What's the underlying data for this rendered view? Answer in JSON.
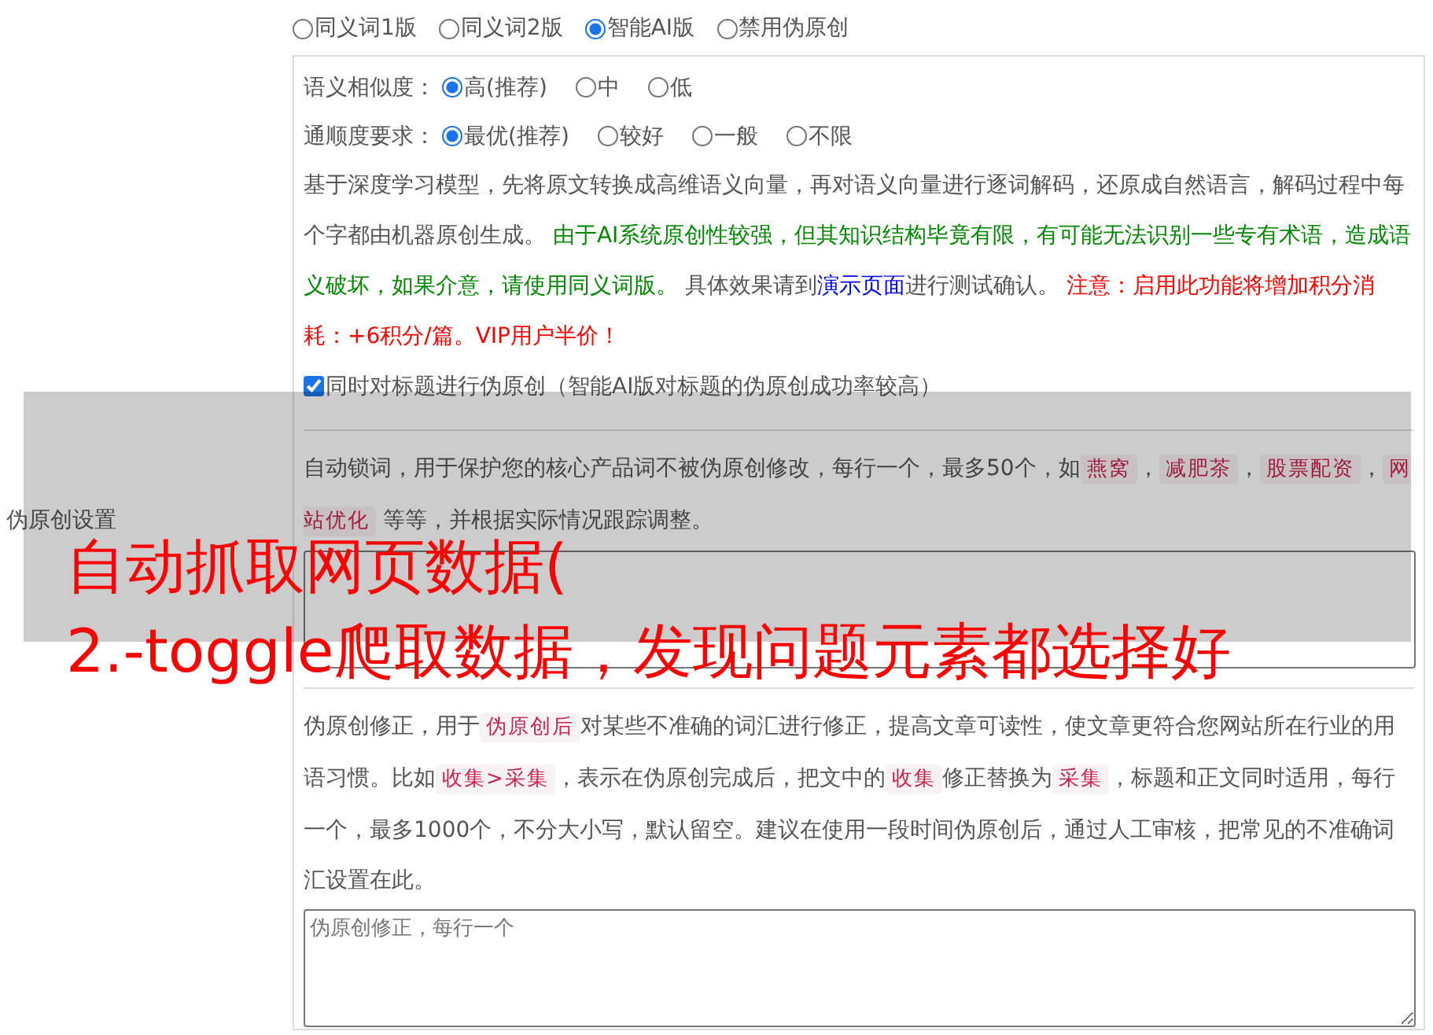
{
  "mode_options": [
    {
      "label": "同义词1版",
      "selected": false
    },
    {
      "label": "同义词2版",
      "selected": false
    },
    {
      "label": "智能AI版",
      "selected": true
    },
    {
      "label": "禁用伪原创",
      "selected": false
    }
  ],
  "settings_label": "伪原创设置",
  "similarity": {
    "label": "语义相似度：",
    "options": [
      {
        "label": "高(推荐)",
        "selected": true
      },
      {
        "label": "中",
        "selected": false
      },
      {
        "label": "低",
        "selected": false
      }
    ]
  },
  "fluency": {
    "label": "通顺度要求：",
    "options": [
      {
        "label": "最优(推荐)",
        "selected": true
      },
      {
        "label": "较好",
        "selected": false
      },
      {
        "label": "一般",
        "selected": false
      },
      {
        "label": "不限",
        "selected": false
      }
    ]
  },
  "ai_description": [
    {
      "kind": "plain",
      "text": "基于深度学习模型，先将原文转换成高维语义向量，再对语义向量进行逐词解码，还原成自然语言，解码过程中每个字都由机器原创生成。 "
    },
    {
      "kind": "green",
      "text": "由于AI系统原创性较强，但其知识结构毕竟有限，有可能无法识别一些专有术语，造成语义破坏，如果介意，请使用同义词版。"
    },
    {
      "kind": "plain",
      "text": " 具体效果请到"
    },
    {
      "kind": "link",
      "text": "演示页面"
    },
    {
      "kind": "plain",
      "text": "进行测试确认。 "
    },
    {
      "kind": "red",
      "text": "注意：启用此功能将增加积分消耗：+6积分/篇。VIP用户半价！"
    }
  ],
  "title_option": {
    "label": "同时对标题进行伪原创（智能AI版对标题的伪原创成功率较高）",
    "checked": true
  },
  "lock_words": {
    "description": [
      {
        "kind": "plain",
        "text": "自动锁词，用于保护您的核心产品词不被伪原创修改，每行一个，最多50个，如"
      },
      {
        "kind": "code",
        "text": "燕窝"
      },
      {
        "kind": "plain",
        "text": "，"
      },
      {
        "kind": "code",
        "text": "减肥茶"
      },
      {
        "kind": "plain",
        "text": "，"
      },
      {
        "kind": "code",
        "text": "股票配资"
      },
      {
        "kind": "plain",
        "text": "，"
      },
      {
        "kind": "code",
        "text": "网站优化"
      },
      {
        "kind": "plain",
        "text": " 等等，并根据实际情况跟踪调整。"
      }
    ]
  },
  "correction": {
    "description": [
      {
        "kind": "plain",
        "text": "伪原创修正，用于"
      },
      {
        "kind": "code",
        "text": "伪原创后"
      },
      {
        "kind": "plain",
        "text": "对某些不准确的词汇进行修正，提高文章可读性，使文章更符合您网站所在行业的用语习惯。比如"
      },
      {
        "kind": "code",
        "text": "收集>采集"
      },
      {
        "kind": "plain",
        "text": "，表示在伪原创完成后，把文中的"
      },
      {
        "kind": "code",
        "text": "收集"
      },
      {
        "kind": "plain",
        "text": "修正替换为"
      },
      {
        "kind": "code",
        "text": "采集"
      },
      {
        "kind": "plain",
        "text": "，标题和正文同时适用，每行一个，最多1000个，不分大小写，默认留空。建议在使用一段时间伪原创后，通过人工审核，把常见的不准确词汇设置在此。"
      }
    ],
    "placeholder": "伪原创修正，每行一个"
  },
  "overlay": {
    "lines": [
      "自动抓取网页数据(",
      "2.-toggle爬取数据，发现问题元素都选择好"
    ]
  }
}
